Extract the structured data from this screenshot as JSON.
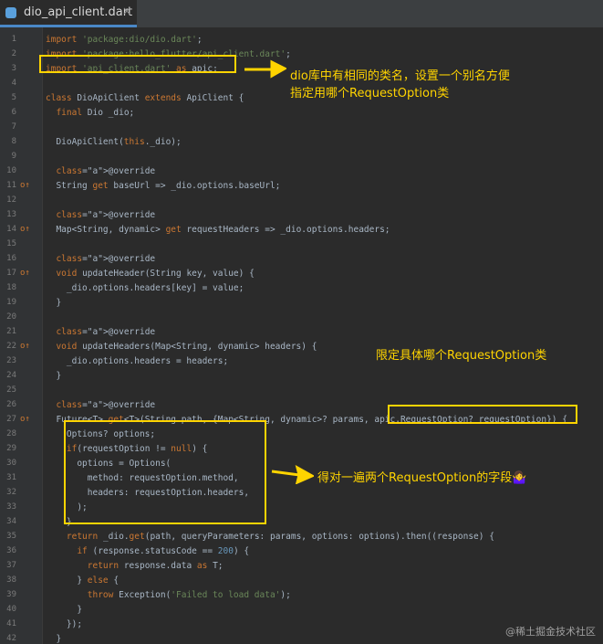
{
  "tab": {
    "title": "dio_api_client.dart",
    "close": "×"
  },
  "line_numbers": [
    "1",
    "2",
    "3",
    "4",
    "5",
    "6",
    "7",
    "8",
    "9",
    "10",
    "11",
    "12",
    "13",
    "14",
    "15",
    "16",
    "17",
    "18",
    "19",
    "20",
    "21",
    "22",
    "23",
    "24",
    "25",
    "26",
    "27",
    "28",
    "29",
    "30",
    "31",
    "32",
    "33",
    "34",
    "35",
    "36",
    "37",
    "38",
    "39",
    "40",
    "41",
    "42"
  ],
  "markers": {
    "11": "o↑",
    "14": "o↑",
    "17": "o↑",
    "22": "o↑",
    "27": "o↑"
  },
  "code": [
    "import 'package:dio/dio.dart';",
    "import 'package:hello_flutter/api_client.dart';",
    "import 'api_client.dart' as apic;",
    "",
    "class DioApiClient extends ApiClient {",
    "  final Dio _dio;",
    "",
    "  DioApiClient(this._dio);",
    "",
    "  @override",
    "  String get baseUrl => _dio.options.baseUrl;",
    "",
    "  @override",
    "  Map<String, dynamic> get requestHeaders => _dio.options.headers;",
    "",
    "  @override",
    "  void updateHeader(String key, value) {",
    "    _dio.options.headers[key] = value;",
    "  }",
    "",
    "  @override",
    "  void updateHeaders(Map<String, dynamic> headers) {",
    "    _dio.options.headers = headers;",
    "  }",
    "",
    "  @override",
    "  Future<T> get<T>(String path, {Map<String, dynamic>? params, apic.RequestOption? requestOption}) {",
    "    Options? options;",
    "    if(requestOption != null) {",
    "      options = Options(",
    "        method: requestOption.method,",
    "        headers: requestOption.headers,",
    "      );",
    "    }",
    "    return _dio.get(path, queryParameters: params, options: options).then((response) {",
    "      if (response.statusCode == 200) {",
    "        return response.data as T;",
    "      } else {",
    "        throw Exception('Failed to load data');",
    "      }",
    "    });",
    "  }"
  ],
  "annotations": {
    "note1": [
      "dio库中有相同的类名，设置一个别名方便",
      "指定用哪个RequestOption类"
    ],
    "note2": "限定具体哪个RequestOption类",
    "note3": "得对一遍两个RequestOption的字段🤷‍♀️"
  },
  "colors": {
    "highlight": "#ffd400",
    "keyword": "#cc7832",
    "string": "#6a8759",
    "function": "#ffc66d",
    "annotation": "#bbb529"
  },
  "watermark": "@稀土掘金技术社区"
}
